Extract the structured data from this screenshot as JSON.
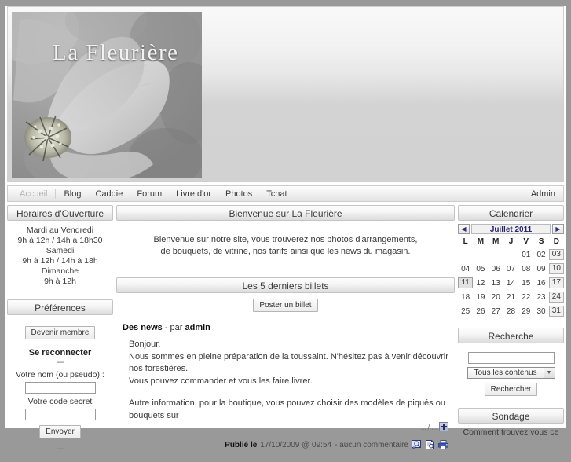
{
  "site": {
    "banner_title": "La Fleurière"
  },
  "nav": {
    "items": [
      {
        "label": "Accueil",
        "active": true
      },
      {
        "label": "Blog",
        "active": false
      },
      {
        "label": "Caddie",
        "active": false
      },
      {
        "label": "Forum",
        "active": false
      },
      {
        "label": "Livre d'or",
        "active": false
      },
      {
        "label": "Photos",
        "active": false
      },
      {
        "label": "Tchat",
        "active": false
      }
    ],
    "admin_label": "Admin"
  },
  "left": {
    "hours": {
      "title": "Horaires d'Ouverture",
      "lines": [
        "Mardi au Vendredi",
        "9h à 12h / 14h à 18h30",
        "Samedi",
        "9h à 12h / 14h à 18h",
        "Dimanche",
        "9h à 12h"
      ]
    },
    "prefs": {
      "title": "Préférences",
      "become_member_label": "Devenir membre",
      "reconnect_title": "Se reconnecter",
      "separator": "----",
      "name_label": "Votre nom (ou pseudo) :",
      "name_value": "",
      "pass_label": "Votre code secret",
      "pass_value": "",
      "submit_label": "Envoyer",
      "bottom_dots": "----"
    }
  },
  "main": {
    "welcome": {
      "title": "Bienvenue sur La Fleurière",
      "line1": "Bienvenue sur notre site, vous trouverez nos photos d'arrangements,",
      "line2": "de bouquets, de vitrine, nos tarifs ainsi que les news du magasin."
    },
    "posts": {
      "title": "Les 5 derniers billets",
      "post_button_label": "Poster un billet"
    },
    "article": {
      "title": "Des news",
      "by_label": "- par",
      "author": "admin",
      "paragraph1_line1": "Bonjour,",
      "paragraph1_line2": "Nous sommes en pleine préparation de la toussaint. N'hésitez pas à venir découvrir nos forestières.",
      "paragraph1_line3": "Vous pouvez commander et vous les faire livrer.",
      "paragraph2": "Autre information, pour la boutique, vous pouvez choisir des modèles de piqués ou bouquets sur",
      "more_label": "... / ...",
      "published_label": "Publié le",
      "published_date": "17/10/2009 @ 09:54",
      "comments_label": "- aucun commentaire"
    }
  },
  "right": {
    "calendar": {
      "title": "Calendrier",
      "prev_label": "◀",
      "next_label": "▶",
      "month_label": "Juillet 2011",
      "weekdays": [
        "L",
        "M",
        "M",
        "J",
        "V",
        "S",
        "D"
      ],
      "weeks": [
        [
          "",
          "",
          "",
          "",
          "01",
          "02",
          "03"
        ],
        [
          "04",
          "05",
          "06",
          "07",
          "08",
          "09",
          "10"
        ],
        [
          "11",
          "12",
          "13",
          "14",
          "15",
          "16",
          "17"
        ],
        [
          "18",
          "19",
          "20",
          "21",
          "22",
          "23",
          "24"
        ],
        [
          "25",
          "26",
          "27",
          "28",
          "29",
          "30",
          "31"
        ]
      ],
      "today": "11",
      "boxed_column": 6
    },
    "search": {
      "title": "Recherche",
      "input_value": "",
      "select_value": "Tous les contenus",
      "button_label": "Rechercher"
    },
    "poll": {
      "title": "Sondage",
      "question": "Comment trouvez vous ce"
    }
  }
}
